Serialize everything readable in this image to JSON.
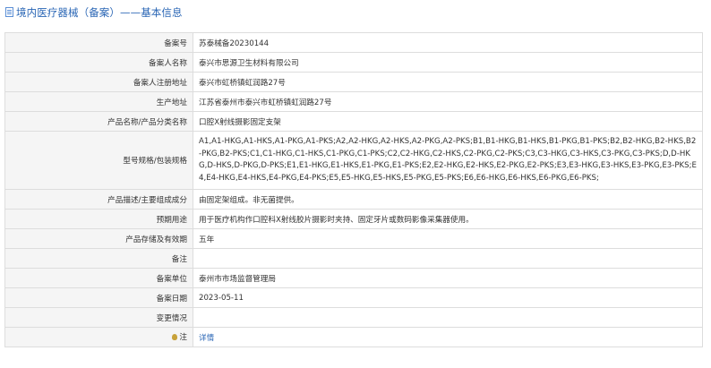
{
  "header": {
    "title": "境内医疗器械（备案）——基本信息",
    "icon": "document-icon"
  },
  "rows": [
    {
      "label": "备案号",
      "value": "苏泰械备20230144"
    },
    {
      "label": "备案人名称",
      "value": "泰兴市思源卫生材料有限公司"
    },
    {
      "label": "备案人注册地址",
      "value": "泰兴市虹桥镇虹润路27号"
    },
    {
      "label": "生产地址",
      "value": "江苏省泰州市泰兴市虹桥镇虹润路27号"
    },
    {
      "label": "产品名称/产品分类名称",
      "value": "口腔X射线摄影固定支架"
    },
    {
      "label": "型号规格/包装规格",
      "value": "A1,A1-HKG,A1-HKS,A1-PKG,A1-PKS;A2,A2-HKG,A2-HKS,A2-PKG,A2-PKS;B1,B1-HKG,B1-HKS,B1-PKG,B1-PKS;B2,B2-HKG,B2-HKS,B2-PKG,B2-PKS;C1,C1-HKG,C1-HKS,C1-PKG,C1-PKS;C2,C2-HKG,C2-HKS,C2-PKG,C2-PKS;C3,C3-HKG,C3-HKS,C3-PKG,C3-PKS;D,D-HKG,D-HKS,D-PKG,D-PKS;E1,E1-HKG,E1-HKS,E1-PKG,E1-PKS;E2,E2-HKG,E2-HKS,E2-PKG,E2-PKS;E3,E3-HKG,E3-HKS,E3-PKG,E3-PKS;E4,E4-HKG,E4-HKS,E4-PKG,E4-PKS;E5,E5-HKG,E5-HKS,E5-PKG,E5-PKS;E6,E6-HKG,E6-HKS,E6-PKG,E6-PKS;"
    },
    {
      "label": "产品描述/主要组成成分",
      "value": "由固定架组成。非无菌提供。"
    },
    {
      "label": "预期用途",
      "value": "用于医疗机构作口腔科X射线胶片摄影时夹持、固定牙片或数码影像采集器使用。"
    },
    {
      "label": "产品存储及有效期",
      "value": "五年"
    },
    {
      "label": "备注",
      "value": ""
    },
    {
      "label": "备案单位",
      "value": "泰州市市场监督管理局"
    },
    {
      "label": "备案日期",
      "value": "2023-05-11"
    },
    {
      "label": "变更情况",
      "value": ""
    },
    {
      "label": "注",
      "value": "详情",
      "icon": "lightbulb-icon"
    }
  ],
  "colors": {
    "accent": "#2a66b5",
    "label_bg": "#f5f5f5",
    "border": "#dddddd"
  }
}
